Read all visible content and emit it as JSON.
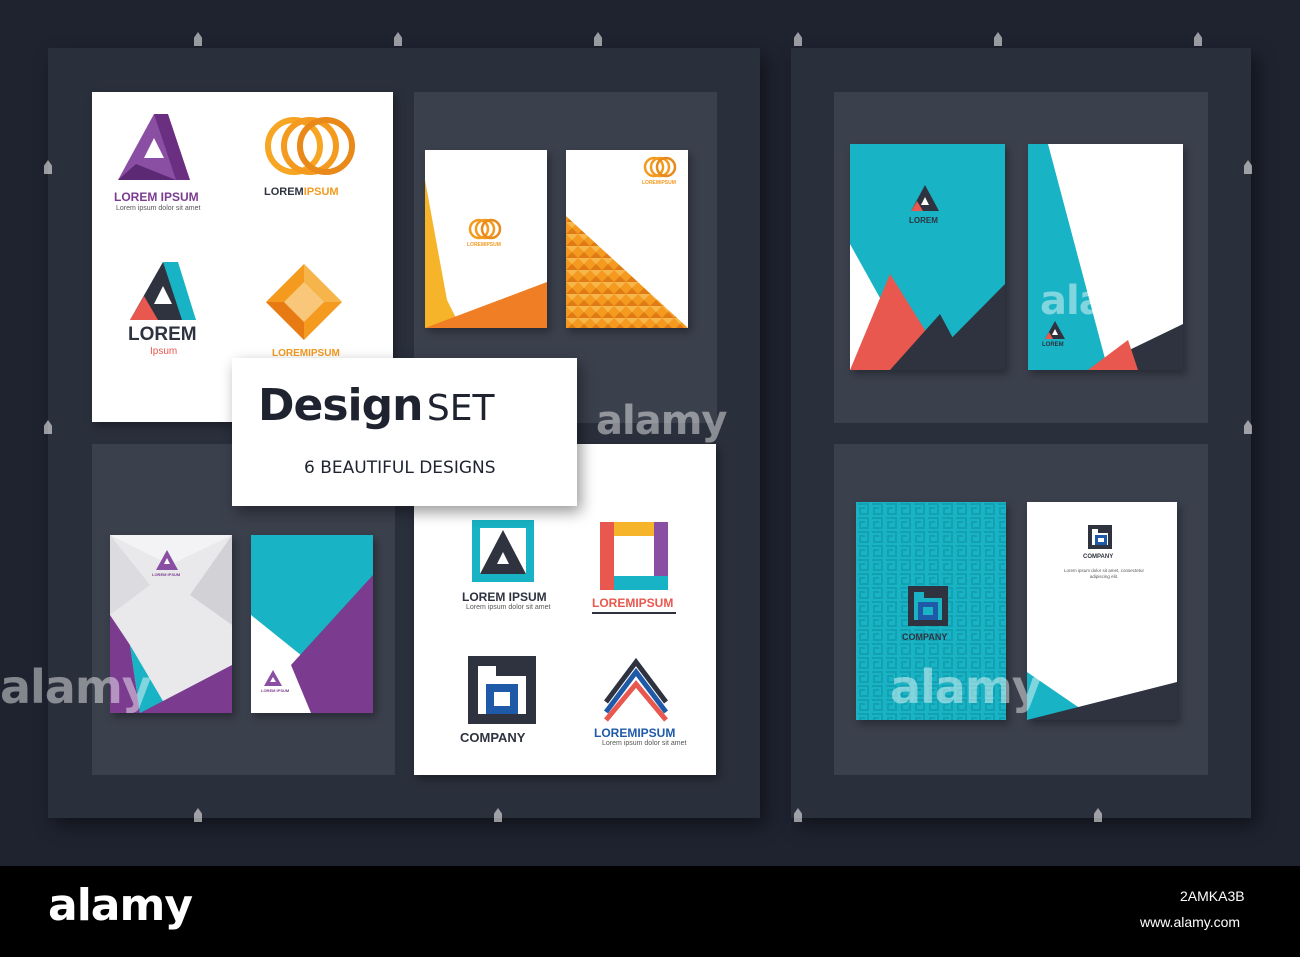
{
  "title": {
    "main": "Design",
    "suffix": "SET",
    "subtitle": "6 BEAUTIFUL DESIGNS"
  },
  "logos": {
    "lorem_ipsum_big": "LOREM IPSUM",
    "lorem_ipsum_sub": "Lorem ipsum dolor sit amet",
    "loremipsum_a": "LOREM",
    "loremipsum_b": "IPSUM",
    "lorem": "LOREM",
    "ipsum_small": "Ipsum",
    "company": "COMPANY",
    "lorem_small": "LOREM",
    "company_body": "Lorem ipsum dolor sit amet, consectetur adipiscing elit."
  },
  "watermark": {
    "text": "alamy",
    "footer_text": "alamy",
    "image_id": "2AMKA3B",
    "url": "www.alamy.com"
  },
  "colors": {
    "teal": "#18b3c4",
    "purple": "#7b3c8f",
    "orange": "#f39a1f",
    "dark": "#2f3340",
    "red": "#e8584e",
    "blue": "#1e5aa8"
  }
}
